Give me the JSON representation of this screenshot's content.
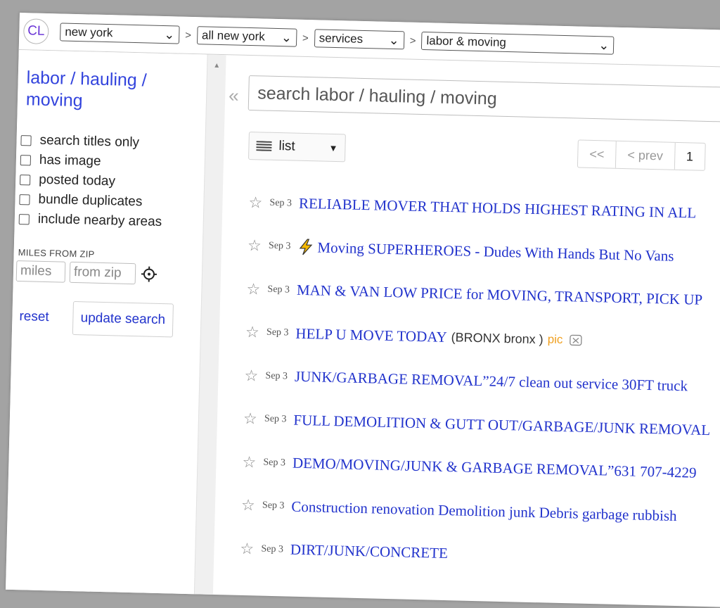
{
  "logo": "CL",
  "breadcrumb": [
    {
      "value": "new york",
      "width": 170
    },
    {
      "value": "all new york",
      "width": 142
    },
    {
      "value": "services",
      "width": 128
    },
    {
      "value": "labor & moving",
      "width": 274
    }
  ],
  "breadcrumb_separator": ">",
  "sidebar": {
    "category_title_line1": "labor / hauling /",
    "category_title_line2": "moving",
    "filters": [
      {
        "label": "search titles only",
        "checked": false
      },
      {
        "label": "has image",
        "checked": false
      },
      {
        "label": "posted today",
        "checked": false
      },
      {
        "label": "bundle duplicates",
        "checked": false
      },
      {
        "label": "include nearby areas",
        "checked": false
      }
    ],
    "miles_label": "MILES FROM ZIP",
    "miles_placeholder": "miles",
    "zip_placeholder": "from zip",
    "reset_label": "reset",
    "update_label": "update search"
  },
  "main": {
    "collapse_glyph": "«",
    "search_placeholder": "search labor / hauling / moving",
    "view_mode": "list",
    "pager": {
      "first": "<<",
      "prev": "< prev",
      "current": "1"
    }
  },
  "results": [
    {
      "date": "Sep 3",
      "title": "RELIABLE MOVER THAT HOLDS HIGHEST RATING IN ALL",
      "bolt": false
    },
    {
      "date": "Sep 3",
      "title": "Moving SUPERHEROES - Dudes With Hands But No Vans",
      "bolt": true
    },
    {
      "date": "Sep 3",
      "title": "MAN & VAN LOW PRICE for MOVING, TRANSPORT, PICK UP",
      "bolt": false
    },
    {
      "date": "Sep 3",
      "title": "HELP U MOVE TODAY",
      "bolt": false,
      "hood": "(BRONX bronx )",
      "pic": "pic"
    },
    {
      "date": "Sep 3",
      "title": "JUNK/GARBAGE REMOVAL”24/7 clean out service 30FT truck",
      "bolt": false
    },
    {
      "date": "Sep 3",
      "title": "FULL DEMOLITION & GUTT OUT/GARBAGE/JUNK REMOVAL",
      "bolt": false
    },
    {
      "date": "Sep 3",
      "title": "DEMO/MOVING/JUNK & GARBAGE REMOVAL”631 707-4229",
      "bolt": false
    },
    {
      "date": "Sep 3",
      "title": "Construction renovation Demolition junk Debris garbage rubbish",
      "bolt": false
    },
    {
      "date": "Sep 3",
      "title": "DIRT/JUNK/CONCRETE",
      "bolt": false
    }
  ],
  "colors": {
    "link": "#2233cc",
    "logo": "#6a35d6",
    "pic": "#f0a020"
  }
}
